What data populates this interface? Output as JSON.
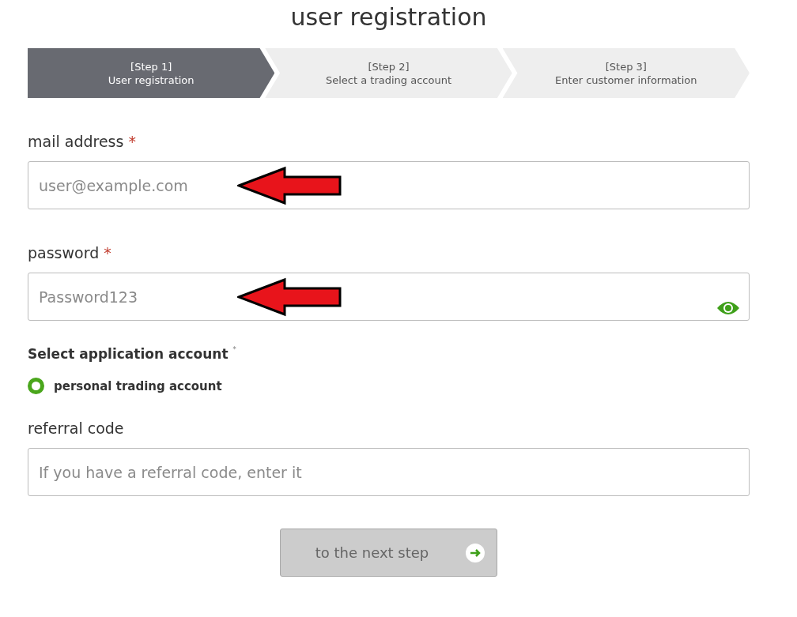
{
  "title": "user registration",
  "steps": [
    {
      "number": "[Step 1]",
      "label": "User registration",
      "selected": true
    },
    {
      "number": "[Step 2]",
      "label": "Select a trading account",
      "selected": false
    },
    {
      "number": "[Step 3]",
      "label": "Enter customer information",
      "selected": false
    }
  ],
  "fields": [
    {
      "label": "mail address",
      "required": true,
      "placeholder": "user@example.com",
      "annotated": true
    },
    {
      "label": "password",
      "required": true,
      "placeholder": "Password123",
      "show_toggle": true,
      "annotated": true
    }
  ],
  "account": {
    "label": "Select application account",
    "required_mark": "*",
    "options": [
      {
        "label": "personal trading account",
        "selected": true
      }
    ]
  },
  "referral": {
    "label": "referral code",
    "placeholder": "If you have a referral code, enter it"
  },
  "next_button": {
    "label": "to the next step",
    "disabled": true
  }
}
